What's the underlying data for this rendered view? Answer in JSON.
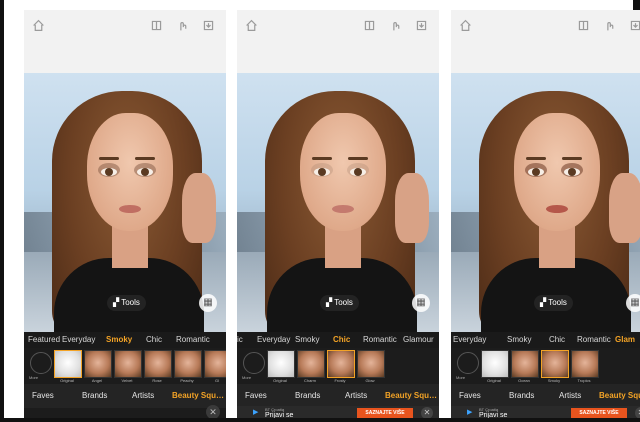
{
  "panels": [
    {
      "categories": [
        "Featured",
        "Everyday",
        "Smoky",
        "Chic",
        "Romantic"
      ],
      "active_category": "Smoky",
      "tools_label": "Tools",
      "more_label": "More",
      "thumbs": [
        "Original",
        "Angel",
        "Velvet",
        "Rose",
        "Peachy",
        "Gl"
      ],
      "selected_thumb": 0,
      "tabs": [
        "Faves",
        "Brands",
        "Artists",
        "Beauty Squ…"
      ],
      "active_tab": "Beauty Squ…",
      "close_label": "✕",
      "has_ad": false
    },
    {
      "categories": [
        "ic",
        "Everyday",
        "Smoky",
        "Chic",
        "Romantic",
        "Glamour"
      ],
      "active_category": "Chic",
      "tools_label": "Tools",
      "more_label": "More",
      "thumbs": [
        "Original",
        "Charm",
        "Frosty",
        "Glow"
      ],
      "selected_thumb": 2,
      "tabs": [
        "Faves",
        "Brands",
        "Artists",
        "Beauty Squ…"
      ],
      "active_tab": "Beauty Squ…",
      "has_ad": true,
      "ad": {
        "provider": "BT Croatia",
        "text": "Prijavi se",
        "button": "SAZNAJTE VIŠE",
        "close_label": "✕"
      }
    },
    {
      "categories": [
        "Everyday",
        "Smoky",
        "Chic",
        "Romantic",
        "Glam"
      ],
      "active_category": "Glam",
      "tools_label": "Tools",
      "more_label": "More",
      "thumbs": [
        "Original",
        "Ocean",
        "Smoky",
        "Tropics"
      ],
      "selected_thumb": 2,
      "tabs": [
        "Faves",
        "Brands",
        "Artists",
        "Beauty Squ…"
      ],
      "active_tab": "Beauty Squ…",
      "has_ad": true,
      "ad": {
        "provider": "BT Croatia",
        "text": "Prijavi se",
        "button": "SAZNAJTE VIŠE",
        "close_label": "✕"
      }
    }
  ],
  "icons": [
    "home-icon",
    "compare-icon",
    "touch-icon",
    "save-icon",
    "tools-icon",
    "compare-toggle-icon"
  ],
  "colors": {
    "accent": "#f3a326",
    "ad_button": "#e8541e",
    "bar_dark": "#1c1c1c",
    "top_bar": "#f2f2f2"
  }
}
